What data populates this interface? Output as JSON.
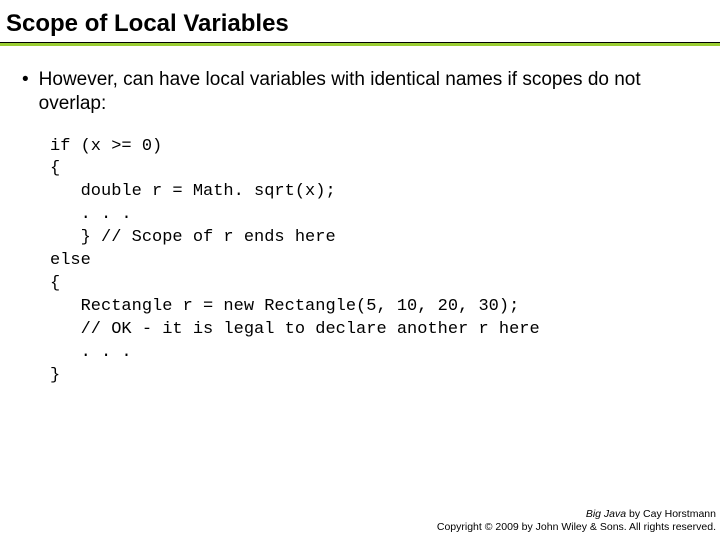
{
  "title": "Scope of Local Variables",
  "bullet_text": "However, can have local variables with identical names if scopes do not overlap:",
  "code": "if (x >= 0)\n{\n   double r = Math. sqrt(x);\n   . . .\n   } // Scope of r ends here\nelse\n{\n   Rectangle r = new Rectangle(5, 10, 20, 30);\n   // OK - it is legal to declare another r here\n   . . .\n}",
  "footer": {
    "book": "Big Java",
    "byline": " by Cay Horstmann",
    "copyright": "Copyright © 2009 by John Wiley & Sons. All rights reserved."
  }
}
